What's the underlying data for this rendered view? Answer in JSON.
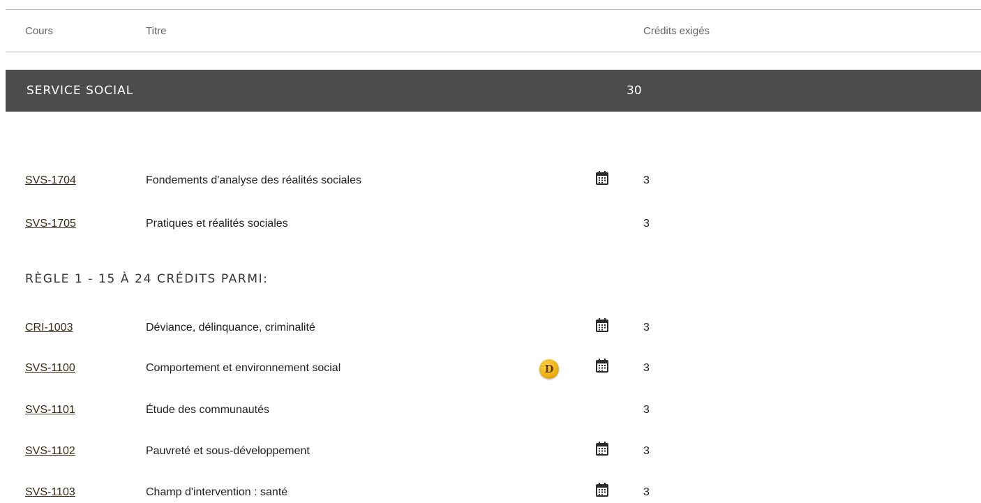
{
  "header": {
    "col_course": "Cours",
    "col_title": "Titre",
    "col_credits": "Crédits exigés"
  },
  "section": {
    "title": "SERVICE SOCIAL",
    "credits": "30"
  },
  "rule1": {
    "heading": "RÈGLE 1 - 15 À 24 CRÉDITS PARMI:"
  },
  "courses": [
    {
      "code": "SVS-1704",
      "title": "Fondements d'analyse des réalités sociales",
      "credits": "3",
      "calendar": true
    },
    {
      "code": "SVS-1705",
      "title": "Pratiques et réalités sociales",
      "credits": "3",
      "calendar": false
    },
    {
      "code": "CRI-1003",
      "title": "Déviance, délinquance, criminalité",
      "credits": "3",
      "calendar": true
    },
    {
      "code": "SVS-1100",
      "title": "Comportement et environnement social",
      "credits": "3",
      "calendar": true,
      "badge": "D"
    },
    {
      "code": "SVS-1101",
      "title": "Étude des communautés",
      "credits": "3",
      "calendar": false
    },
    {
      "code": "SVS-1102",
      "title": "Pauvreté et sous-développement",
      "credits": "3",
      "calendar": true
    },
    {
      "code": "SVS-1103",
      "title": "Champ d'intervention : santé",
      "credits": "3",
      "calendar": true
    }
  ],
  "icons": {
    "calendar": "calendar-icon",
    "distance_badge": "distance-badge-icon"
  },
  "colors": {
    "section_bg": "#4c4c4c",
    "link": "#3a2a16",
    "badge": "#e9a60a"
  }
}
